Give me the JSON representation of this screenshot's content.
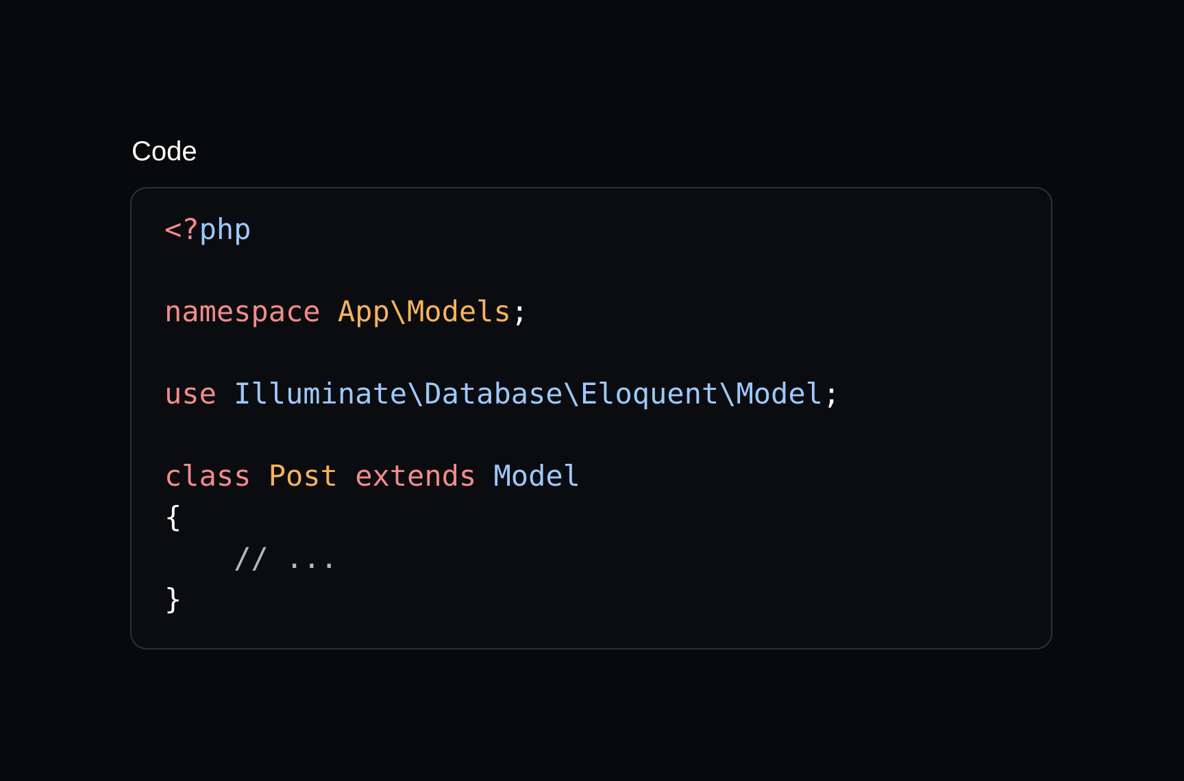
{
  "section": {
    "title": "Code"
  },
  "colors": {
    "background": "#08090b",
    "card_background": "#0b0c0f",
    "card_border": "#2f3034",
    "title": "#ffffff",
    "keyword": "#f28b8b",
    "namespace_or_type": "#f7b35c",
    "identifier": "#9cc9ff",
    "punctuation": "#ffffff",
    "comment": "#b8b8b8"
  },
  "code": {
    "language": "php",
    "lines": [
      {
        "tokens": [
          {
            "text": "<?",
            "role": "keyword"
          },
          {
            "text": "php",
            "role": "identifier"
          }
        ]
      },
      {
        "tokens": []
      },
      {
        "tokens": [
          {
            "text": "namespace",
            "role": "keyword"
          },
          {
            "text": " ",
            "role": "punctuation"
          },
          {
            "text": "App\\Models",
            "role": "namespace_or_type"
          },
          {
            "text": ";",
            "role": "punctuation"
          }
        ]
      },
      {
        "tokens": []
      },
      {
        "tokens": [
          {
            "text": "use",
            "role": "keyword"
          },
          {
            "text": " ",
            "role": "punctuation"
          },
          {
            "text": "Illuminate\\Database\\Eloquent\\Model",
            "role": "identifier"
          },
          {
            "text": ";",
            "role": "punctuation"
          }
        ]
      },
      {
        "tokens": []
      },
      {
        "tokens": [
          {
            "text": "class",
            "role": "keyword"
          },
          {
            "text": " ",
            "role": "punctuation"
          },
          {
            "text": "Post",
            "role": "namespace_or_type"
          },
          {
            "text": " ",
            "role": "punctuation"
          },
          {
            "text": "extends",
            "role": "keyword"
          },
          {
            "text": " ",
            "role": "punctuation"
          },
          {
            "text": "Model",
            "role": "identifier"
          }
        ]
      },
      {
        "tokens": [
          {
            "text": "{",
            "role": "punctuation"
          }
        ]
      },
      {
        "tokens": [
          {
            "text": "    // ...",
            "role": "comment"
          }
        ]
      },
      {
        "tokens": [
          {
            "text": "}",
            "role": "punctuation"
          }
        ]
      }
    ]
  }
}
